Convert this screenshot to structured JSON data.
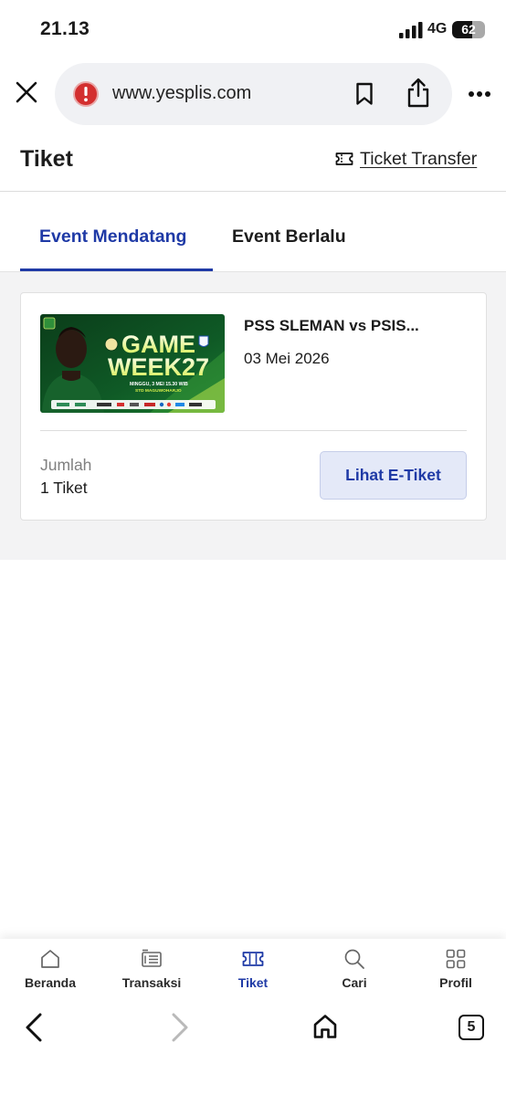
{
  "status_bar": {
    "time": "21.13",
    "network": "4G",
    "battery": "62",
    "battery_level": 0.62
  },
  "browser": {
    "url": "www.yesplis.com"
  },
  "header": {
    "title": "Tiket",
    "transfer_label": "Ticket Transfer"
  },
  "tabs": [
    {
      "label": "Event Mendatang",
      "active": true
    },
    {
      "label": "Event Berlalu",
      "active": false
    }
  ],
  "ticket_card": {
    "event_title": "PSS SLEMAN vs PSIS...",
    "event_date": "03 Mei 2026",
    "quantity_label": "Jumlah",
    "quantity_value": "1 Tiket",
    "button_label": "Lihat E-Tiket",
    "poster": {
      "line1": "GAME",
      "line2": "WEEK27",
      "info1": "MINGGU, 3 MEI 15.30 WIB",
      "info2": "STD MAGUWOHARJO"
    }
  },
  "bottom_nav": [
    {
      "label": "Beranda",
      "icon": "home-icon"
    },
    {
      "label": "Transaksi",
      "icon": "receipt-icon"
    },
    {
      "label": "Tiket",
      "icon": "ticket-icon",
      "active": true
    },
    {
      "label": "Cari",
      "icon": "search-icon"
    },
    {
      "label": "Profil",
      "icon": "grid-icon"
    }
  ],
  "toolbar": {
    "tab_count": "5"
  },
  "colors": {
    "accent": "#1f3aa6",
    "button_bg": "#e4e9f8",
    "content_bg": "#f3f3f4",
    "poster_green": "#0f5a26"
  }
}
